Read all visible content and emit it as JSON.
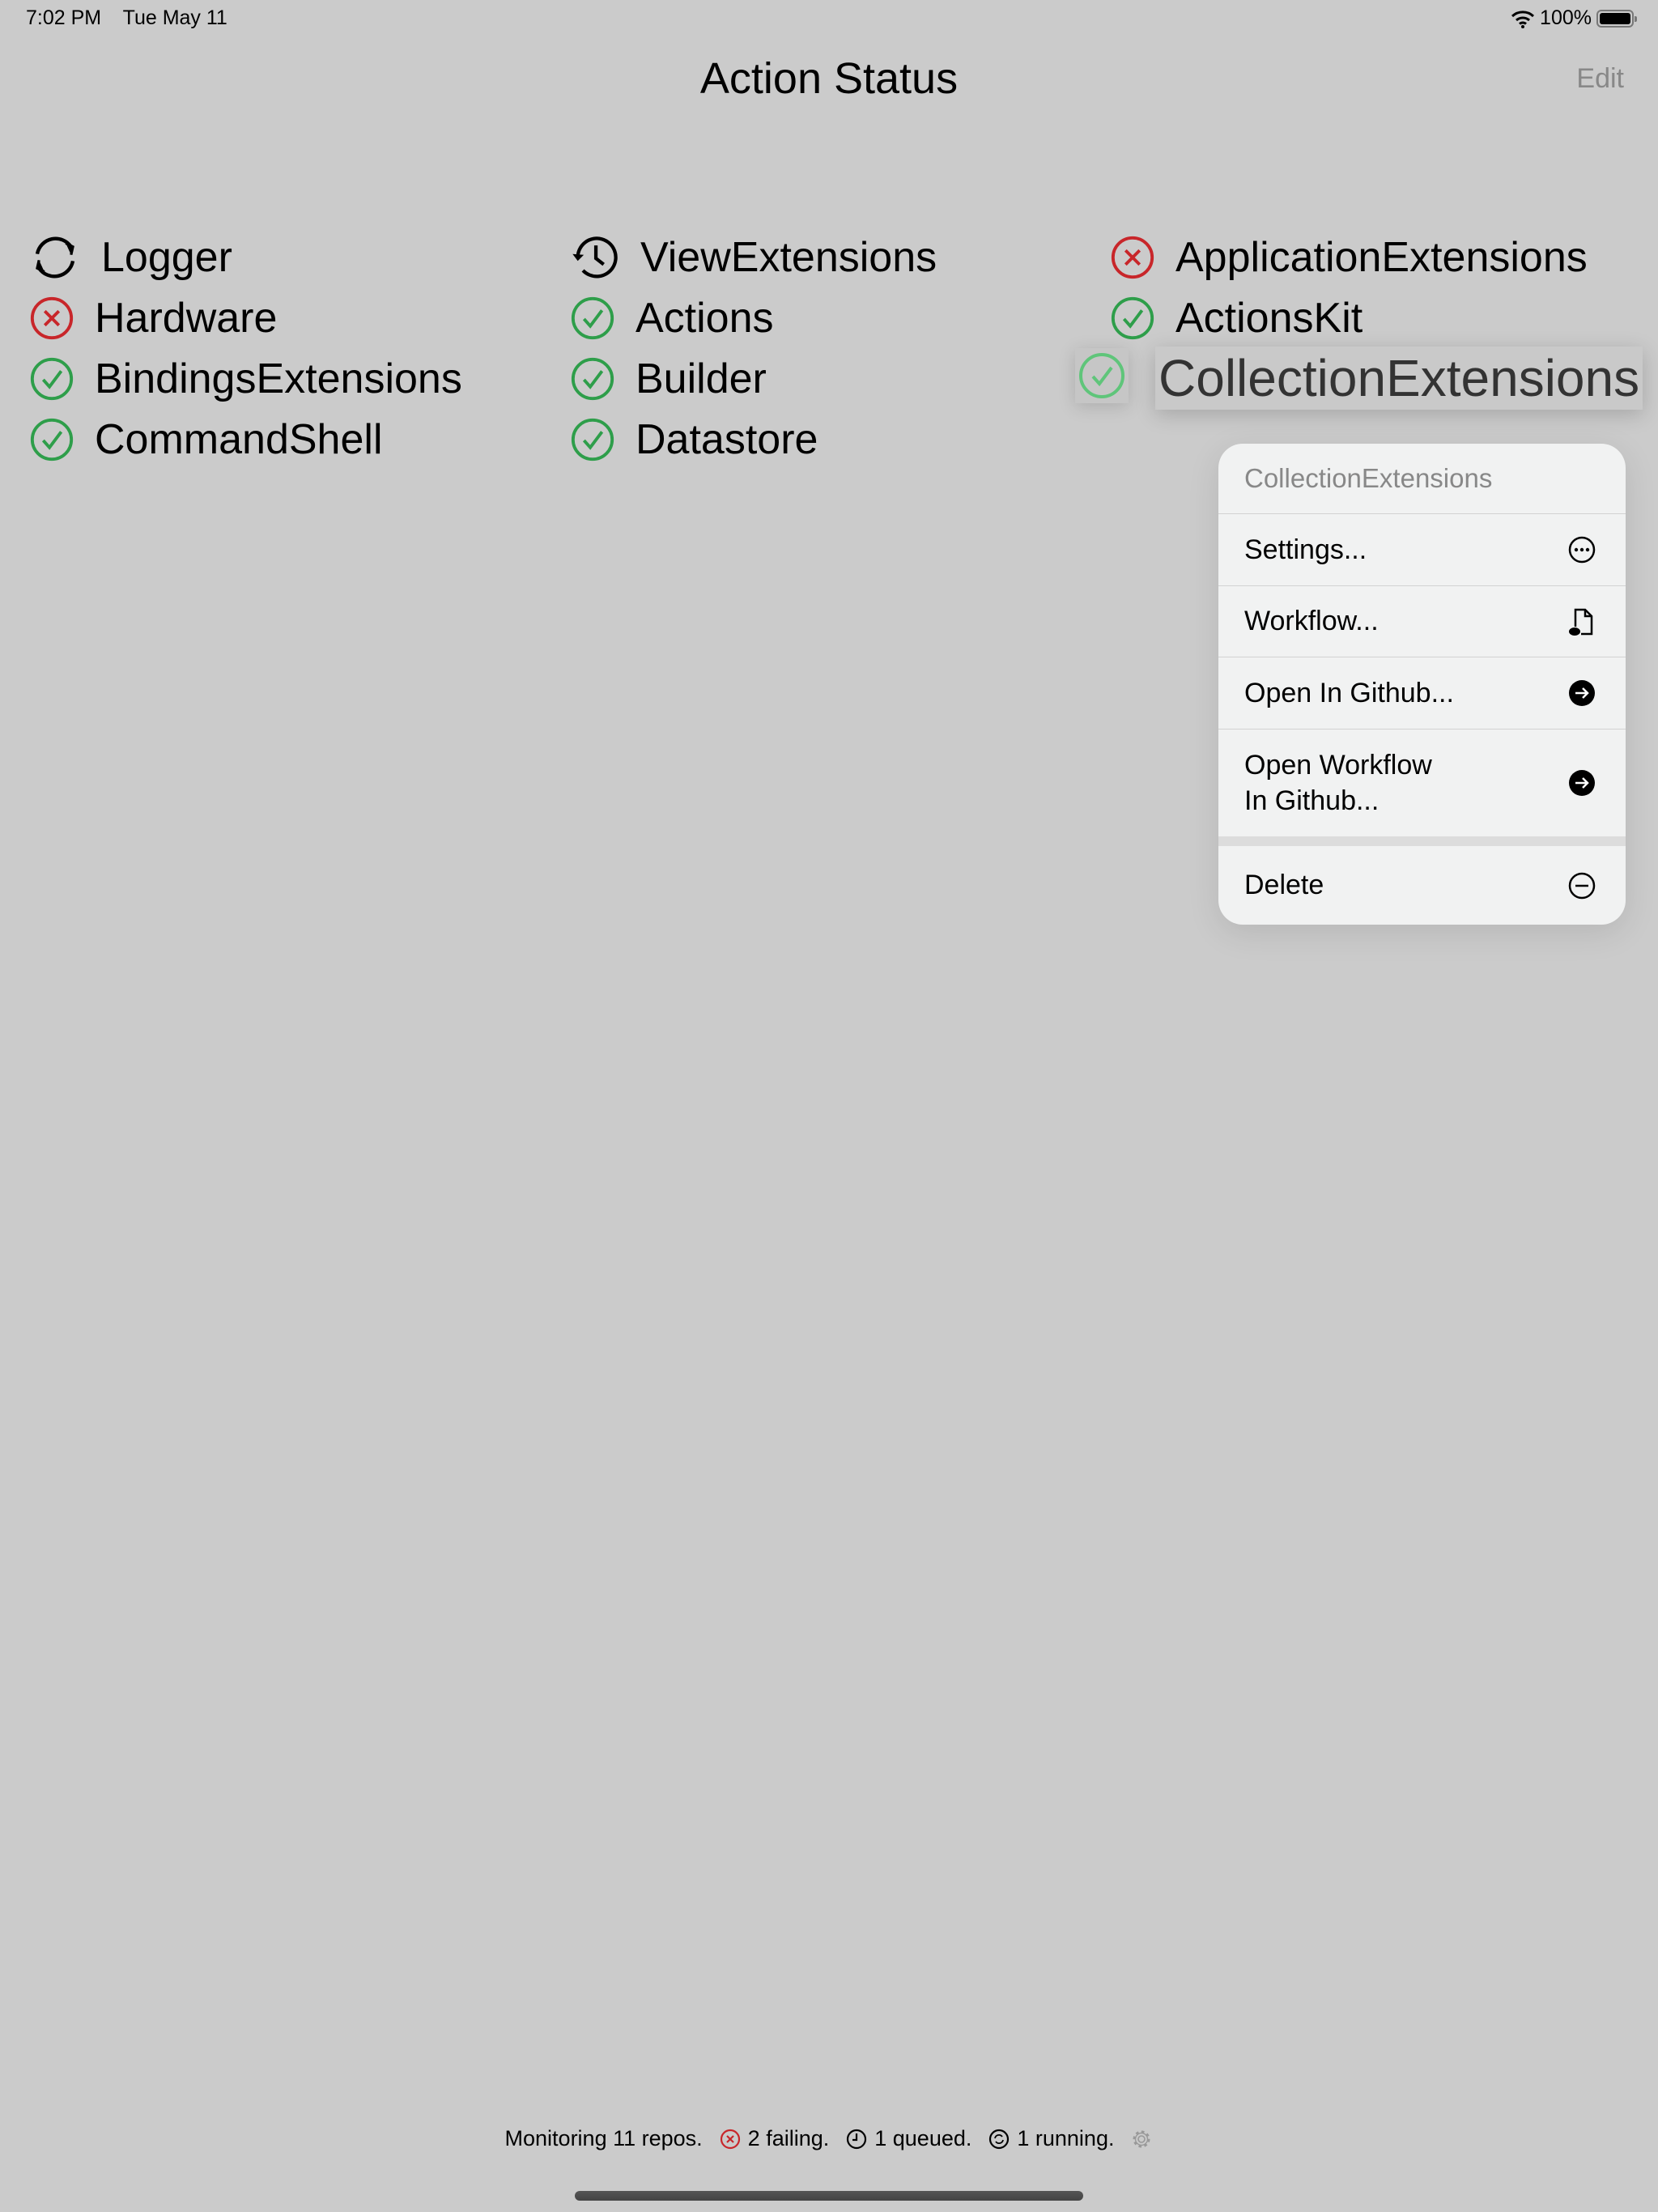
{
  "status_bar": {
    "time": "7:02 PM",
    "date": "Tue May 11",
    "battery": "100%"
  },
  "header": {
    "title": "Action Status",
    "edit_label": "Edit"
  },
  "repos": [
    {
      "name": "Logger",
      "status": "running"
    },
    {
      "name": "Hardware",
      "status": "failing"
    },
    {
      "name": "BindingsExtensions",
      "status": "passing"
    },
    {
      "name": "CommandShell",
      "status": "passing"
    },
    {
      "name": "ViewExtensions",
      "status": "queued"
    },
    {
      "name": "Actions",
      "status": "passing"
    },
    {
      "name": "Builder",
      "status": "passing"
    },
    {
      "name": "Datastore",
      "status": "passing"
    },
    {
      "name": "ApplicationExtensions",
      "status": "failing"
    },
    {
      "name": "ActionsKit",
      "status": "passing"
    },
    {
      "name": "CollectionExtensions",
      "status": "passing"
    }
  ],
  "context_menu": {
    "title": "CollectionExtensions",
    "items": [
      {
        "label": "Settings...",
        "icon": "ellipsis-circle-icon"
      },
      {
        "label": "Workflow...",
        "icon": "doc-ellipsis-icon"
      },
      {
        "label": "Open In Github...",
        "icon": "arrow-right-circle-fill-icon"
      },
      {
        "label": "Open Workflow\nIn Github...",
        "icon": "arrow-right-circle-fill-icon"
      },
      {
        "label": "Delete",
        "icon": "minus-circle-icon"
      }
    ]
  },
  "footer": {
    "monitoring": "Monitoring 11 repos.",
    "failing": "2 failing.",
    "queued": "1 queued.",
    "running": "1 running."
  },
  "colors": {
    "passing": "#2e9e4a",
    "failing": "#c8262a",
    "background": "#cbcbcb"
  }
}
